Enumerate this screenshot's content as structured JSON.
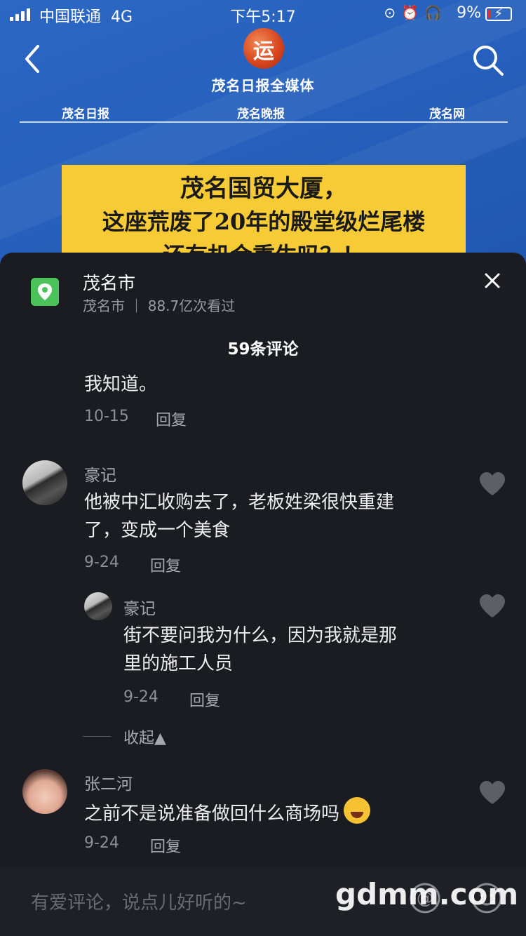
{
  "status_bar": {
    "carrier": "中国联通",
    "network": "4G",
    "time": "下午5:17",
    "battery": "9%"
  },
  "header": {
    "media_title": "茂名日报全媒体",
    "logo_glyph": "运",
    "nav": [
      "茂名日报",
      "茂名晚报",
      "茂名网"
    ]
  },
  "banner": {
    "line1": "茂名国贸大厦，",
    "line2": "这座荒废了20年的殿堂级烂尾楼",
    "line3": "还有机会重生吗？！"
  },
  "sheet": {
    "location": {
      "name": "茂名市",
      "subtitle": "茂名市 ｜ 88.7亿次看过"
    },
    "count": "59条评论",
    "comments": [
      {
        "text": "我知道。",
        "date": "10-15",
        "reply": "回复"
      },
      {
        "user": "豪记",
        "text1": "他被中汇收购去了，老板姓梁很快重建",
        "text2": "了，变成一个美食",
        "date": "9-24",
        "reply": "回复",
        "sub": {
          "user": "豪记",
          "text1": "街不要问我为什么，因为我就是那",
          "text2": "里的施工人员",
          "date": "9-24",
          "reply": "回复"
        }
      },
      {
        "user": "张二河",
        "text": "之前不是说准备做回什么商场吗",
        "date": "9-24",
        "reply": "回复"
      }
    ],
    "collapse": "收起▲",
    "input_placeholder": "有爱评论，说点儿好听的~",
    "watermark": "gdmm.com"
  },
  "colors": {
    "sheet_bg": "#1b1c22",
    "location_icon": "#4cc35a",
    "banner_bg": "#f6cb36",
    "header_bg": "#2760bd"
  }
}
